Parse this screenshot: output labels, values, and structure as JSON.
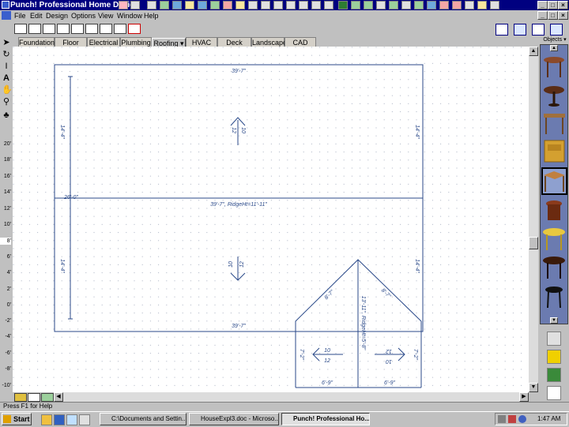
{
  "window": {
    "title": "Punch! Professional Home Design"
  },
  "menu": [
    "File",
    "Edit",
    "Design",
    "Options",
    "View",
    "Window",
    "Help"
  ],
  "tabs": [
    "Foundation",
    "Floor",
    "Electrical",
    "Plumbing",
    "Roofing",
    "HVAC",
    "Deck",
    "Landscape",
    "CAD"
  ],
  "active_tab": "Roofing",
  "objects_panel": {
    "label": "Objects"
  },
  "ruler": [
    "20'",
    "18'",
    "16'",
    "14'",
    "12'",
    "10'",
    "8'",
    "6'",
    "4'",
    "2'",
    "0'",
    "-2'",
    "-4'",
    "-6'",
    "-8'",
    "-10'"
  ],
  "plan": {
    "top_dim": "39'-7\"",
    "ridge_label": "39'-7\", RidgeHt=11'-11\"",
    "bottom_dim": "39'-7\"",
    "left_overall": "26'-0\"",
    "left_upper": "14'-4\"",
    "left_lower": "14'-4\"",
    "right_upper": "14'-4\"",
    "right_lower": "14'-4\"",
    "upper_pitch_rise": "10",
    "upper_pitch_run": "12",
    "lower_pitch_rise": "10",
    "lower_pitch_run": "12",
    "gable_left_slope": "8'-7\"",
    "gable_right_slope": "8'-7\"",
    "gable_ridge": "13'-11\", RidgeHt=5'-8\"",
    "small_left_dim": "7'-2\"",
    "small_right_dim": "7'-2\"",
    "small_pitch_left_rise": "10",
    "small_pitch_left_run": "12",
    "small_pitch_right_rise": "12",
    "small_pitch_right_run": "10",
    "bottom_left_dim": "6'-9\"",
    "bottom_right_dim": "6'-9\""
  },
  "status": {
    "text": "Press F1 for Help"
  },
  "taskbar": {
    "start": "Start",
    "tasks": [
      "C:\\Documents and Settin...",
      "HouseExpl3.doc - Microso...",
      "Punch! Professional Ho..."
    ],
    "active_task": "Punch! Professional Ho...",
    "clock": "1:47 AM"
  },
  "colors": {
    "title_bg": "#000080",
    "plan_line": "#2b4a8a",
    "canvas_bg": "#ffffff",
    "objects_bg": "#6b7bb0"
  }
}
